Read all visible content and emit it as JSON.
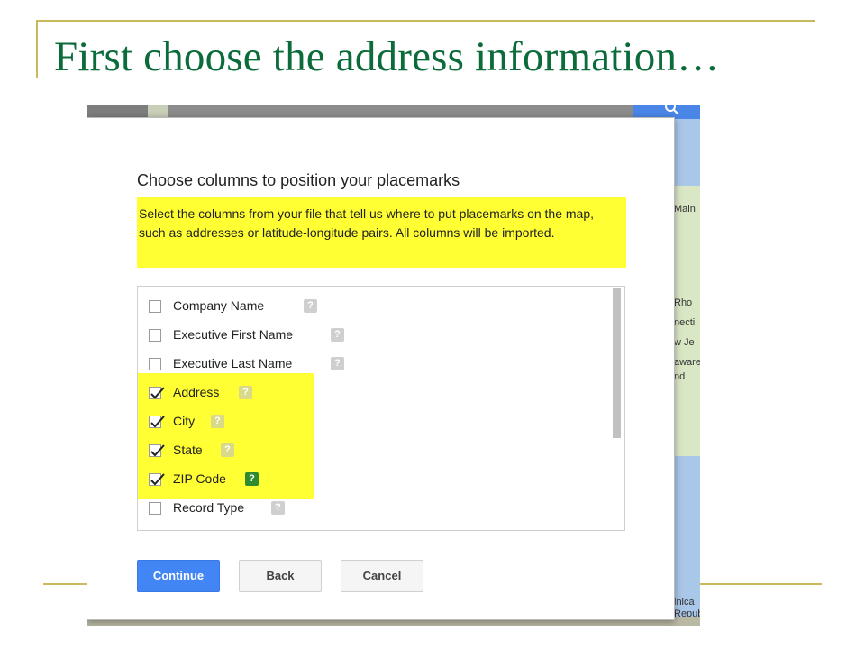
{
  "slide": {
    "title": "First choose the address information…"
  },
  "dialog": {
    "title": "Choose columns to position your placemarks",
    "description": "Select the columns from your file that tell us where to put placemarks on the map, such as addresses or latitude-longitude pairs. All columns will be imported.",
    "columns": [
      {
        "label": "Company Name",
        "checked": false
      },
      {
        "label": "Executive First Name",
        "checked": false
      },
      {
        "label": "Executive Last Name",
        "checked": false
      },
      {
        "label": "Address",
        "checked": true
      },
      {
        "label": "City",
        "checked": true
      },
      {
        "label": "State",
        "checked": true
      },
      {
        "label": "ZIP Code",
        "checked": true
      },
      {
        "label": "Record Type",
        "checked": false
      }
    ],
    "help_glyph": "?",
    "buttons": {
      "continue": "Continue",
      "back": "Back",
      "cancel": "Cancel"
    }
  },
  "map": {
    "labels": [
      "Main",
      "Rho",
      "necti",
      "w Je",
      "aware",
      "nd",
      "inica",
      "Republ"
    ]
  },
  "colors": {
    "highlight": "#ffff33",
    "title_green": "#0b6b3a",
    "accent_blue": "#4285f4",
    "checked_help_green": "#2e8b2e"
  }
}
